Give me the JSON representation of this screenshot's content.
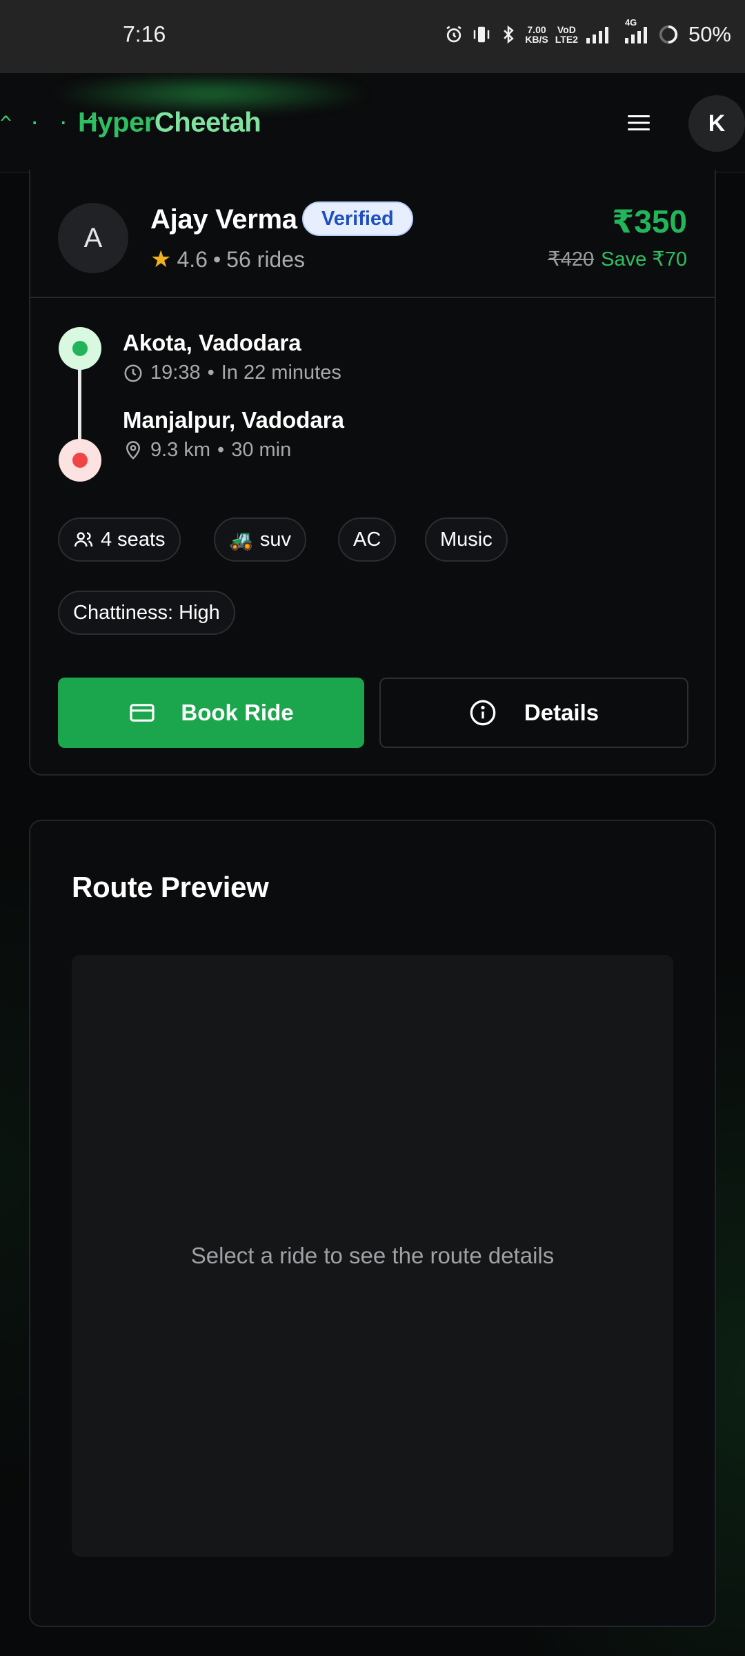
{
  "status_bar": {
    "time": "7:16",
    "net_speed_value": "7.00",
    "net_speed_unit": "KB/S",
    "volte_top": "VoD",
    "volte_bottom": "LTE2",
    "network_type": "4G",
    "battery": "50%"
  },
  "header": {
    "logo_face": "^ · · ^",
    "brand_first": "Hyper",
    "brand_second": "Cheetah",
    "menu_icon": "hamburger-menu-icon",
    "user_initial": "K"
  },
  "ride": {
    "driver_initial": "A",
    "driver_name": "Ajay Verma",
    "verified_label": "Verified",
    "rating": "4.6",
    "rides": "56 rides",
    "price": "₹350",
    "old_price": "₹420",
    "savings": "Save ₹70",
    "pickup": {
      "name": "Akota, Vadodara",
      "time": "19:38",
      "eta": "In 22 minutes"
    },
    "dropoff": {
      "name": "Manjalpur, Vadodara",
      "distance": "9.3 km",
      "duration": "30 min"
    },
    "chips": {
      "seats": "4 seats",
      "vehicle_emoji": "🚜",
      "vehicle": "suv",
      "ac": "AC",
      "music": "Music",
      "chattiness": "Chattiness: High"
    },
    "book_label": "Book Ride",
    "details_label": "Details"
  },
  "route_preview": {
    "title": "Route Preview",
    "empty_text": "Select a ride to see the route details"
  },
  "colors": {
    "accent_green": "#1ba64d",
    "price_green": "#23b55a",
    "pickup_dot": "#21b45a",
    "dropoff_dot": "#ef4545",
    "verified_blue": "#1f4fbf",
    "star_yellow": "#f2b01e"
  }
}
